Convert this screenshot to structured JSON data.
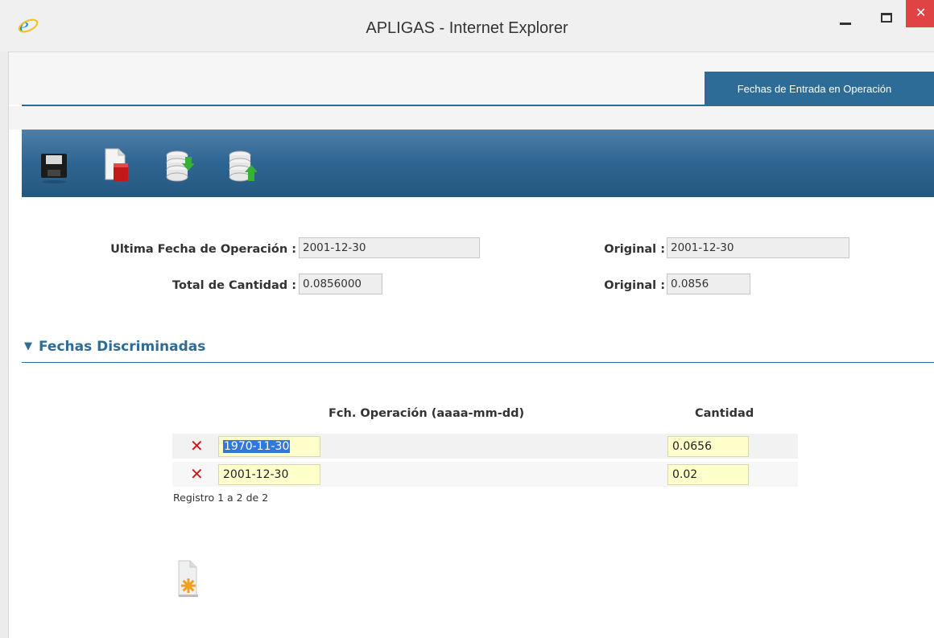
{
  "window": {
    "title": "APLIGAS - Internet Explorer",
    "close_glyph": "✕"
  },
  "tabs": [
    {
      "label": "Fechas de Entrada en Operación",
      "active": true
    }
  ],
  "toolbar": {
    "buttons": [
      {
        "icon": "floppy-disk-save-icon"
      },
      {
        "icon": "document-delete-icon"
      },
      {
        "icon": "database-import-icon"
      },
      {
        "icon": "database-export-icon"
      }
    ]
  },
  "form": {
    "last_date": {
      "label": "Ultima Fecha de Operación :",
      "value": "2001-12-30"
    },
    "last_date_original": {
      "label": "Original :",
      "value": "2001-12-30"
    },
    "total_qty": {
      "label": "Total de Cantidad :",
      "value": "0.0856000"
    },
    "total_qty_original": {
      "label": "Original :",
      "value": "0.0856"
    }
  },
  "section": {
    "title": "Fechas Discriminadas",
    "expanded_glyph": "▼"
  },
  "grid": {
    "headers": {
      "date": "Fch. Operación (aaaa-mm-dd)",
      "qty": "Cantidad"
    },
    "delete_glyph": "✕",
    "rows": [
      {
        "date": "1970-11-30",
        "qty": "0.0656",
        "selected": true
      },
      {
        "date": "2001-12-30",
        "qty": "0.02",
        "selected": false
      }
    ],
    "footer": "Registro 1 a 2 de 2"
  },
  "colors": {
    "accent": "#2d6c97",
    "delete": "#cc1a1a",
    "cell_bg": "#ffffcc",
    "selection": "#3377dd"
  }
}
